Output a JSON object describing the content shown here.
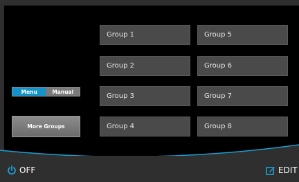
{
  "groups": [
    "Group 1",
    "Group 2",
    "Group 3",
    "Group 4",
    "Group 5",
    "Group 6",
    "Group 7",
    "Group 8"
  ],
  "toggle": {
    "menu_label": "Menu",
    "manual_label": "Manual",
    "selected": "Menu"
  },
  "more_groups_label": "More Groups",
  "footer": {
    "off_label": "OFF",
    "edit_label": "EDIT"
  },
  "colors": {
    "accent": "#1792c9",
    "tile": "#4a4a4a",
    "background": "#000000"
  }
}
